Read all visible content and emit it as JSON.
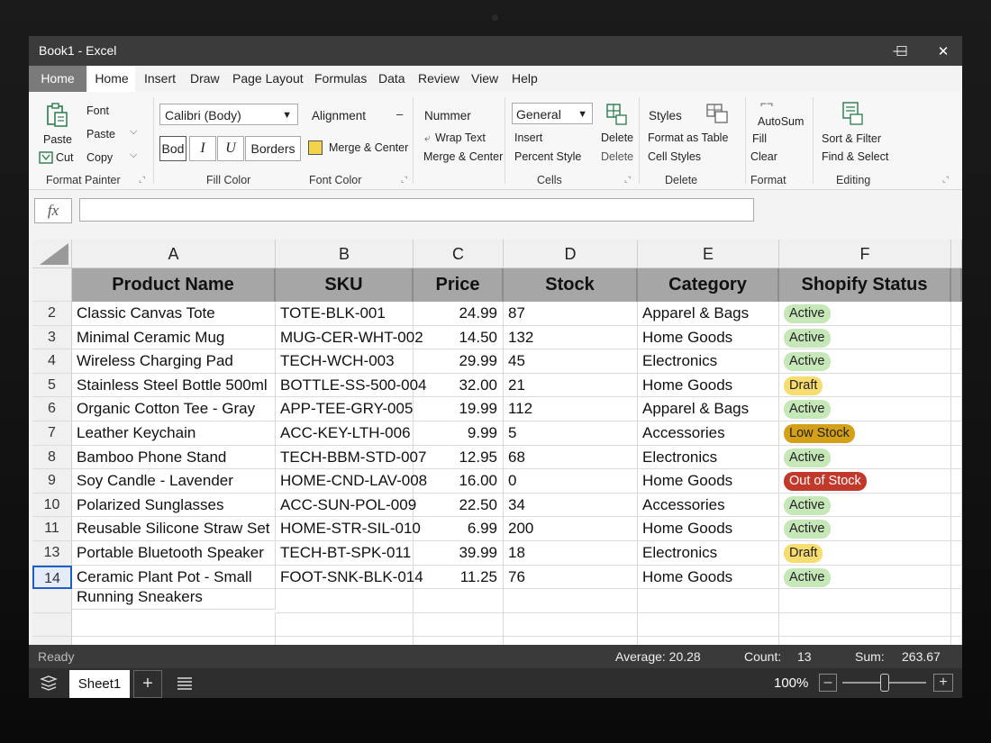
{
  "window": {
    "title": "Book1 - Excel",
    "minimize": "—",
    "maximize": "☐",
    "close": "✕"
  },
  "menu": [
    "Home",
    "Home",
    "Insert",
    "Draw",
    "Page Layout",
    "Formulas",
    "Data",
    "Review",
    "View",
    "Help"
  ],
  "ribbon": {
    "clipboard": {
      "paste": "Paste",
      "cut": "Cut",
      "font": "Font",
      "paste2": "Paste",
      "copy": "Copy",
      "format_painter": "Format Painter"
    },
    "font": {
      "font_name": "Calibri (Body)",
      "bold": "Bod",
      "italic": "I",
      "underline": "U",
      "borders": "Borders",
      "fill_color": "Fill Color"
    },
    "alignment": {
      "alignment": "Alignment",
      "dash": "–",
      "merge_center": "Merge & Center",
      "font_color": "Font Color"
    },
    "number": {
      "nummer": "Nummer",
      "wrap_text": "Wrap Text",
      "merge_center": "Merge & Center"
    },
    "cells": {
      "format": "General",
      "insert": "Insert",
      "percent_style": "Percent Style",
      "delete1": "Delete",
      "delete2": "Delete",
      "cells": "Cells"
    },
    "styles": {
      "styles": "Styles",
      "format_as_table": "Format as Table",
      "cell_styles": "Cell Styles",
      "delete": "Delete"
    },
    "format": {
      "autosum": "AutoSum",
      "fill": "Fill",
      "clear": "Clear",
      "format": "Format"
    },
    "editing": {
      "sort_filter": "Sort & Filter",
      "find_select": "Find & Select",
      "editing": "Editing"
    }
  },
  "formula_bar": {
    "fx": "fx",
    "value": ""
  },
  "columns": [
    "A",
    "B",
    "C",
    "D",
    "E",
    "F"
  ],
  "table": {
    "headers": [
      "Product Name",
      "SKU",
      "Price",
      "Stock",
      "Category",
      "Shopify Status"
    ],
    "rows": [
      {
        "num": "2",
        "name": "Classic Canvas Tote",
        "sku": "TOTE-BLK-001",
        "price": "24.99",
        "stock": "87",
        "category": "Apparel & Bags",
        "status": "Active"
      },
      {
        "num": "3",
        "name": "Minimal Ceramic Mug",
        "sku": "MUG-CER-WHT-002",
        "price": "14.50",
        "stock": "132",
        "category": "Home Goods",
        "status": "Active"
      },
      {
        "num": "4",
        "name": "Wireless Charging Pad",
        "sku": "TECH-WCH-003",
        "price": "29.99",
        "stock": "45",
        "category": "Electronics",
        "status": "Active"
      },
      {
        "num": "5",
        "name": "Stainless Steel Bottle 500ml",
        "sku": "BOTTLE-SS-500-004",
        "price": "32.00",
        "stock": "21",
        "category": "Home Goods",
        "status": "Draft"
      },
      {
        "num": "6",
        "name": "Organic Cotton Tee - Gray",
        "sku": "APP-TEE-GRY-005",
        "price": "19.99",
        "stock": "112",
        "category": "Apparel & Bags",
        "status": "Active"
      },
      {
        "num": "7",
        "name": "Leather Keychain",
        "sku": "ACC-KEY-LTH-006",
        "price": "9.99",
        "stock": "5",
        "category": "Accessories",
        "status": "Low Stock"
      },
      {
        "num": "8",
        "name": "Bamboo Phone Stand",
        "sku": "TECH-BBM-STD-007",
        "price": "12.95",
        "stock": "68",
        "category": "Electronics",
        "status": "Active"
      },
      {
        "num": "9",
        "name": "Soy Candle - Lavender",
        "sku": "HOME-CND-LAV-008",
        "price": "16.00",
        "stock": "0",
        "category": "Home Goods",
        "status": "Out of Stock"
      },
      {
        "num": "10",
        "name": "Polarized Sunglasses",
        "sku": "ACC-SUN-POL-009",
        "price": "22.50",
        "stock": "34",
        "category": "Accessories",
        "status": "Active"
      },
      {
        "num": "11",
        "name": "Reusable Silicone Straw Set",
        "sku": "HOME-STR-SIL-010",
        "price": "6.99",
        "stock": "200",
        "category": "Home Goods",
        "status": "Active"
      },
      {
        "num": "13",
        "name": "Portable Bluetooth Speaker",
        "sku": "TECH-BT-SPK-011",
        "price": "39.99",
        "stock": "18",
        "category": "Electronics",
        "status": "Draft"
      },
      {
        "num": "14",
        "name": "Ceramic Plant Pot - Small",
        "sku": "FOOT-SNK-BLK-014",
        "price": "11.25",
        "stock": "76",
        "category": "Home Goods",
        "status": "Active"
      }
    ],
    "overflow_text": "Running Sneakers"
  },
  "status_colors": {
    "Active": {
      "bg": "#c6e7b8",
      "fg": "#222222"
    },
    "Draft": {
      "bg": "#f7dc6f",
      "fg": "#222222"
    },
    "Low Stock": {
      "bg": "#d4a017",
      "fg": "#222222"
    },
    "Out of Stock": {
      "bg": "#c0392b",
      "fg": "#ffffff"
    }
  },
  "status_bar": {
    "ready": "Ready",
    "average": "Average: 20.28",
    "count_label": "Count:",
    "count": "13",
    "sum_label": "Sum:",
    "sum": "263.67"
  },
  "sheet_bar": {
    "sheet": "Sheet1",
    "add": "+",
    "zoom": "100%",
    "zoom_level": 0.5
  }
}
